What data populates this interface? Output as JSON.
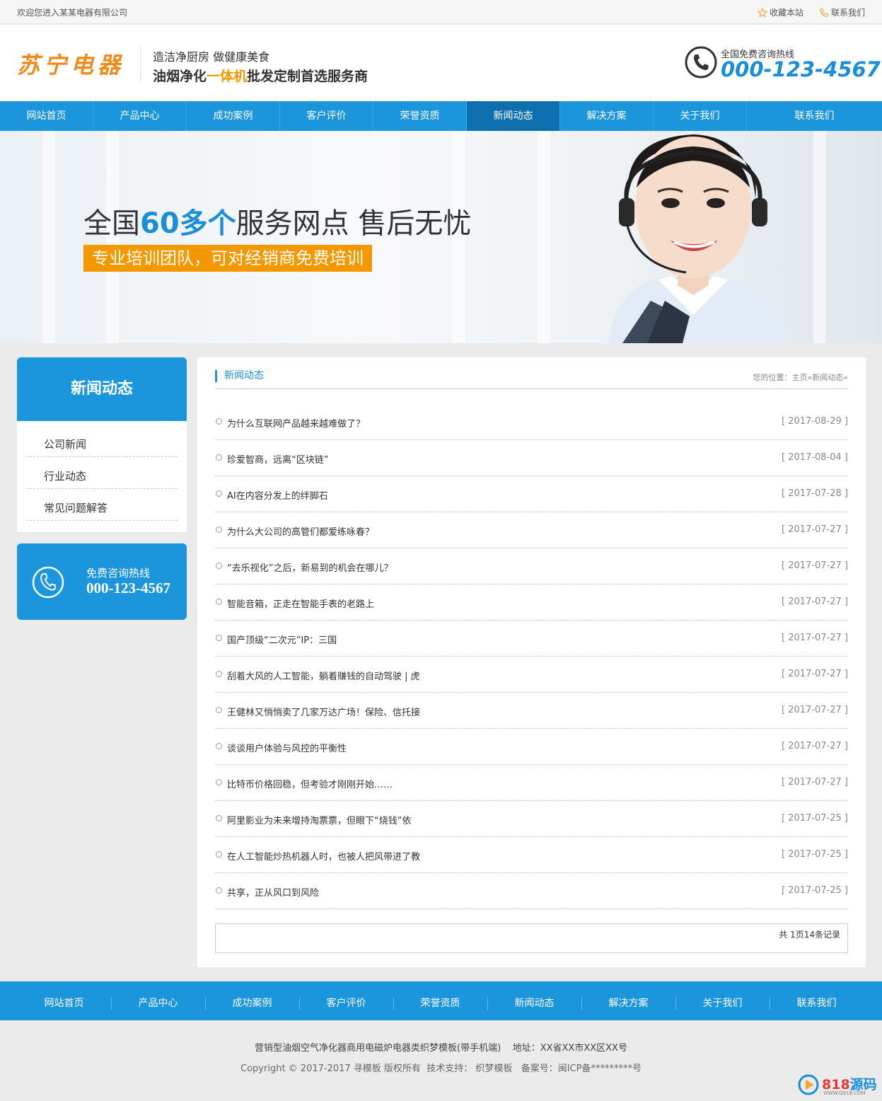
{
  "topbar": {
    "welcome": "欢迎您进入某某电器有限公司",
    "bookmark": "收藏本站",
    "contact": "联系我们"
  },
  "header": {
    "logo": "苏宁电器",
    "slogan_line1": "造洁净厨房 做健康美食",
    "slogan_line2_a": "油烟净化",
    "slogan_line2_hl": "一体机",
    "slogan_line2_b": "批发定制首选服务商",
    "hotline_label": "全国免费咨询热线",
    "hotline_number": "000-123-4567"
  },
  "nav": {
    "items": [
      "网站首页",
      "产品中心",
      "成功案例",
      "客户评价",
      "荣誉资质",
      "新闻动态",
      "解决方案",
      "关于我们",
      "联系我们"
    ],
    "active": "新闻动态"
  },
  "banner": {
    "title_a": "全国",
    "title_big": "60多个",
    "title_b": "服务网点 售后无忧",
    "subtitle": "专业培训团队，可对经销商免费培训"
  },
  "sidebar": {
    "title": "新闻动态",
    "items": [
      "公司新闻",
      "行业动态",
      "常见问题解答"
    ],
    "hotline_label": "免费咨询热线",
    "hotline_number": "000-123-4567"
  },
  "main": {
    "title": "新闻动态",
    "breadcrumb": "您的位置：主页»新闻动态»",
    "news": [
      {
        "title": "为什么互联网产品越来越难做了？",
        "date": "[ 2017-08-29 ]"
      },
      {
        "title": "珍爱智商，远离“区块链”",
        "date": "[ 2017-08-04 ]"
      },
      {
        "title": "AI在内容分发上的绊脚石",
        "date": "[ 2017-07-28 ]"
      },
      {
        "title": "为什么大公司的高管们都爱练咏春？",
        "date": "[ 2017-07-27 ]"
      },
      {
        "title": "“去乐视化”之后，新易到的机会在哪儿？",
        "date": "[ 2017-07-27 ]"
      },
      {
        "title": "智能音箱，正走在智能手表的老路上",
        "date": "[ 2017-07-27 ]"
      },
      {
        "title": "国产顶级“二次元”IP：三国",
        "date": "[ 2017-07-27 ]"
      },
      {
        "title": "刮着大风的人工智能，躺着赚钱的自动驾驶 | 虎",
        "date": "[ 2017-07-27 ]"
      },
      {
        "title": "王健林又悄悄卖了几家万达广场！保险、信托接",
        "date": "[ 2017-07-27 ]"
      },
      {
        "title": "谈谈用户体验与风控的平衡性",
        "date": "[ 2017-07-27 ]"
      },
      {
        "title": "比特币价格回稳，但考验才刚刚开始……",
        "date": "[ 2017-07-27 ]"
      },
      {
        "title": "阿里影业为未来增持淘票票，但眼下“烧钱”依",
        "date": "[ 2017-07-25 ]"
      },
      {
        "title": "在人工智能炒热机器人时，也被人把风带进了教",
        "date": "[ 2017-07-25 ]"
      },
      {
        "title": "共享，正从风口到风险",
        "date": "[ 2017-07-25 ]"
      }
    ],
    "pager": "共 1页14条记录"
  },
  "footer_nav": {
    "items": [
      "网站首页",
      "产品中心",
      "成功案例",
      "客户评价",
      "荣誉资质",
      "新闻动态",
      "解决方案",
      "关于我们",
      "联系我们"
    ]
  },
  "footer": {
    "line1": "营销型油烟空气净化器商用电磁炉电器类织梦模板(带手机端)    地址：XX省XX市XX区XX号",
    "line2": "Copyright © 2017-2017 寻模板 版权所有  技术支持： 织梦模板   备案号：闽ICP备*********号"
  },
  "watermark": {
    "num": "818",
    "text": "源码",
    "url": "WWW.Q818.COM"
  },
  "colors": {
    "brand_blue": "#1b96dd",
    "nav_active": "#0d6fae",
    "accent_orange": "#f39800",
    "logo_orange": "#f08a1c"
  },
  "icons": [
    "star-icon",
    "phone-small-icon",
    "phone-circle-icon",
    "headset-woman-image",
    "play-logo-icon"
  ]
}
